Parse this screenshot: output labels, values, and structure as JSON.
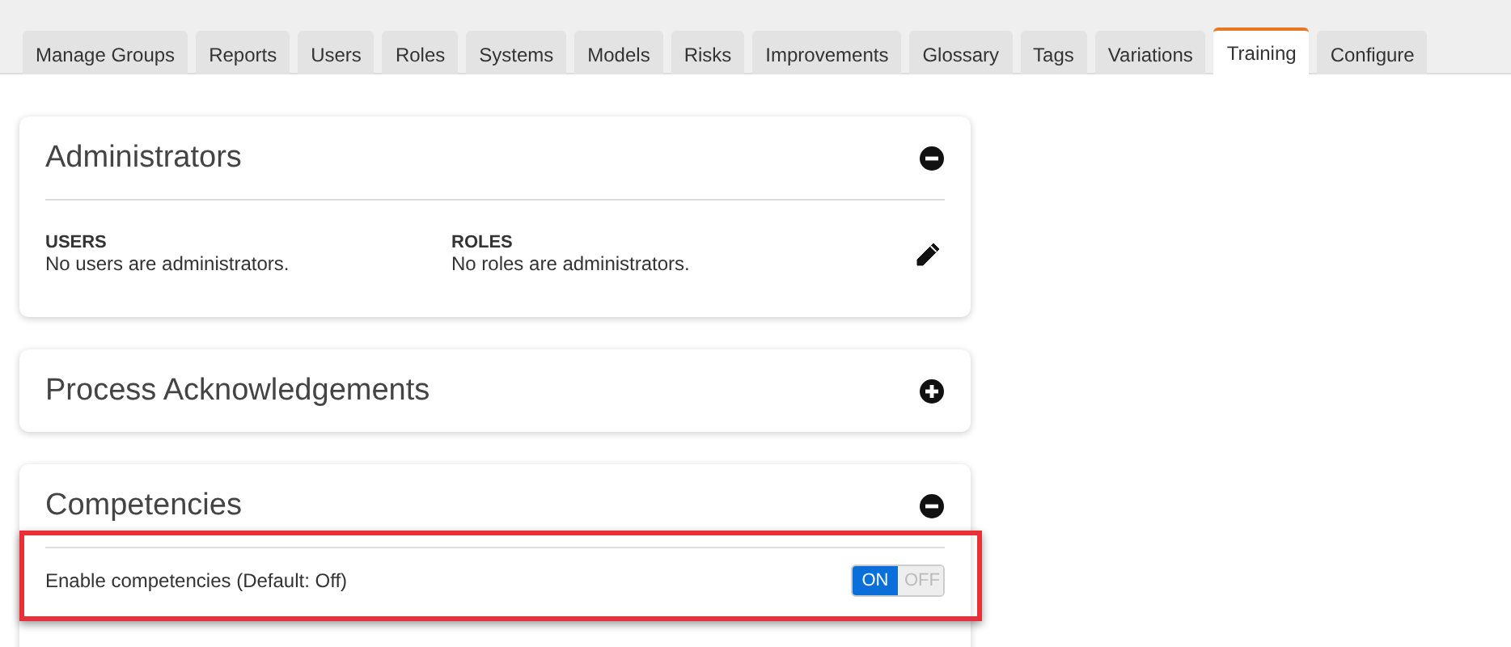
{
  "tabs": [
    {
      "label": "Manage Groups",
      "selected": false
    },
    {
      "label": "Reports",
      "selected": false
    },
    {
      "label": "Users",
      "selected": false
    },
    {
      "label": "Roles",
      "selected": false
    },
    {
      "label": "Systems",
      "selected": false
    },
    {
      "label": "Models",
      "selected": false
    },
    {
      "label": "Risks",
      "selected": false
    },
    {
      "label": "Improvements",
      "selected": false
    },
    {
      "label": "Glossary",
      "selected": false
    },
    {
      "label": "Tags",
      "selected": false
    },
    {
      "label": "Variations",
      "selected": false
    },
    {
      "label": "Training",
      "selected": true
    },
    {
      "label": "Configure",
      "selected": false
    }
  ],
  "panels": [
    {
      "kind": "admins",
      "title": "Administrators",
      "expanded": true,
      "columns": [
        {
          "heading": "USERS",
          "text": "No users are administrators."
        },
        {
          "heading": "ROLES",
          "text": "No roles are administrators."
        }
      ]
    },
    {
      "kind": "plain",
      "title": "Process Acknowledgements",
      "expanded": false
    },
    {
      "kind": "setting",
      "title": "Competencies",
      "expanded": true,
      "highlighted": true,
      "setting": {
        "label": "Enable competencies (Default: Off)",
        "on": true,
        "on_label": "ON",
        "off_label": "OFF"
      }
    }
  ]
}
